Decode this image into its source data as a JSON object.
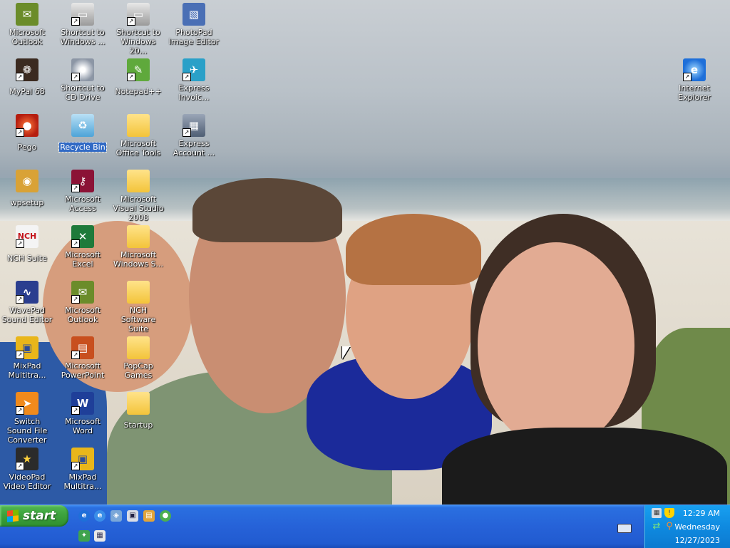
{
  "desktop": {
    "icons": [
      {
        "label": "Microsoft Outlook",
        "icon": "outlook-icon",
        "shortcut": false
      },
      {
        "label": "Shortcut to Windows ...",
        "icon": "drive-icon",
        "shortcut": true
      },
      {
        "label": "Shortcut to Windows 20...",
        "icon": "drive-icon",
        "shortcut": true
      },
      {
        "label": "PhotoPad Image Editor",
        "icon": "photopad-icon",
        "shortcut": false
      },
      {
        "label": "MyPal 68",
        "icon": "mypal-icon",
        "shortcut": true
      },
      {
        "label": "Shortcut to CD Drive",
        "icon": "cd-drive-icon",
        "shortcut": true
      },
      {
        "label": "Notepad++",
        "icon": "notepad-plus-plus-icon",
        "shortcut": true
      },
      {
        "label": "Express Invoic...",
        "icon": "express-invoice-icon",
        "shortcut": true
      },
      {
        "label": "Internet Explorer",
        "icon": "internet-explorer-icon",
        "shortcut": true
      },
      {
        "label": "Pego",
        "icon": "pego-icon",
        "shortcut": true
      },
      {
        "label": "Recycle Bin",
        "icon": "recycle-bin-icon",
        "shortcut": false,
        "selected": true
      },
      {
        "label": "Microsoft Office Tools",
        "icon": "folder-icon",
        "shortcut": false
      },
      {
        "label": "Express Account ...",
        "icon": "express-accounts-icon",
        "shortcut": true
      },
      {
        "label": "wpsetup",
        "icon": "wpsetup-icon",
        "shortcut": false
      },
      {
        "label": "Microsoft Access",
        "icon": "access-icon",
        "shortcut": true
      },
      {
        "label": "Microsoft Visual Studio 2008",
        "icon": "folder-icon",
        "shortcut": false
      },
      {
        "label": "NCH Suite",
        "icon": "nch-suite-icon",
        "shortcut": true
      },
      {
        "label": "Microsoft Excel",
        "icon": "excel-icon",
        "shortcut": true
      },
      {
        "label": "Microsoft Windows S...",
        "icon": "folder-icon",
        "shortcut": false
      },
      {
        "label": "WavePad Sound Editor",
        "icon": "wavepad-icon",
        "shortcut": true
      },
      {
        "label": "Microsoft Outlook",
        "icon": "outlook-icon",
        "shortcut": true
      },
      {
        "label": "NCH Software Suite",
        "icon": "folder-icon",
        "shortcut": false
      },
      {
        "label": "MixPad Multitra...",
        "icon": "mixpad-icon",
        "shortcut": true
      },
      {
        "label": "Microsoft PowerPoint",
        "icon": "powerpoint-icon",
        "shortcut": true
      },
      {
        "label": "PopCap Games",
        "icon": "folder-icon",
        "shortcut": false
      },
      {
        "label": "Switch Sound File Converter",
        "icon": "switch-icon",
        "shortcut": true
      },
      {
        "label": "Microsoft Word",
        "icon": "word-icon",
        "shortcut": true
      },
      {
        "label": "Startup",
        "icon": "folder-icon",
        "shortcut": false
      },
      {
        "label": "VideoPad Video Editor",
        "icon": "videopad-icon",
        "shortcut": true
      },
      {
        "label": "MixPad Multitra...",
        "icon": "mixpad-icon",
        "shortcut": true
      }
    ]
  },
  "taskbar": {
    "start_label": "start",
    "quick_launch": [
      {
        "name": "internet-explorer-icon",
        "glyph": "e"
      },
      {
        "name": "ie-alt-icon",
        "glyph": "e"
      },
      {
        "name": "network-icon",
        "glyph": "◈"
      },
      {
        "name": "window-icon",
        "glyph": "▣"
      },
      {
        "name": "control-icon",
        "glyph": "▤"
      },
      {
        "name": "globe-icon",
        "glyph": "●"
      },
      {
        "name": "windows-flag-icon",
        "glyph": "✦"
      },
      {
        "name": "explorer-icon",
        "glyph": "▦"
      }
    ],
    "tray": {
      "time": "12:29 AM",
      "day": "Wednesday",
      "date": "12/27/2023"
    }
  },
  "colors": {
    "taskbar": "#2662d8",
    "start": "#3ea43e",
    "tray": "#0f8ae0",
    "selection": "#316ac5"
  }
}
